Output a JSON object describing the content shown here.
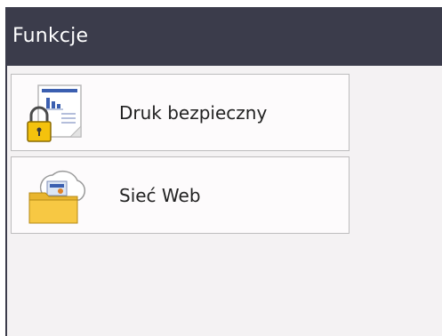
{
  "header": {
    "title": "Funkcje"
  },
  "menu": {
    "items": [
      {
        "label": "Druk bezpieczny",
        "icon": "secure-print-icon"
      },
      {
        "label": "Sieć Web",
        "icon": "web-connect-icon"
      }
    ]
  },
  "colors": {
    "header_bg": "#3b3c4b",
    "panel_bg": "#f4f2f3",
    "item_bg": "#fdfbfc",
    "lock_yellow": "#f4c20d",
    "folder_yellow": "#f7c843",
    "chart_blue": "#3b5fb0"
  }
}
